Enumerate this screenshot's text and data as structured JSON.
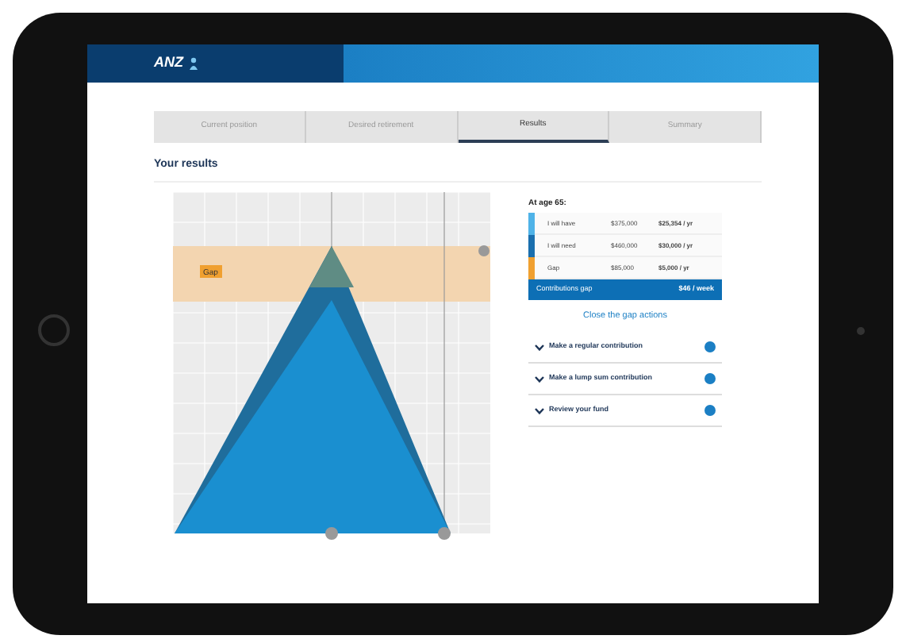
{
  "header": {
    "logo": "ANZ"
  },
  "steps": [
    {
      "label": "Current position",
      "selected": false
    },
    {
      "label": "Desired retirement",
      "selected": false
    },
    {
      "label": "Results",
      "selected": true
    },
    {
      "label": "Summary",
      "selected": false
    }
  ],
  "heading": "Your results",
  "chart": {
    "gap_label": "Gap"
  },
  "summary": {
    "title": "At age 65:",
    "rows": [
      {
        "label": "I will have",
        "amount": "$375,000",
        "annual": "$25,354 / yr",
        "color": "#4fb3e8"
      },
      {
        "label": "I will need",
        "amount": "$460,000",
        "annual": "$30,000 / yr",
        "color": "#1a6fae"
      },
      {
        "label": "Gap",
        "amount": "$85,000",
        "annual": "$5,000 / yr",
        "color": "#f0a030"
      }
    ],
    "footer": {
      "label": "Contributions gap",
      "value": "$46 / week"
    }
  },
  "actions_title": "Close the gap actions",
  "actions": [
    {
      "label": "Make a regular contribution",
      "expanded": false
    },
    {
      "label": "Make a lump sum contribution",
      "expanded": false
    },
    {
      "label": "Review your fund",
      "expanded": false
    }
  ]
}
